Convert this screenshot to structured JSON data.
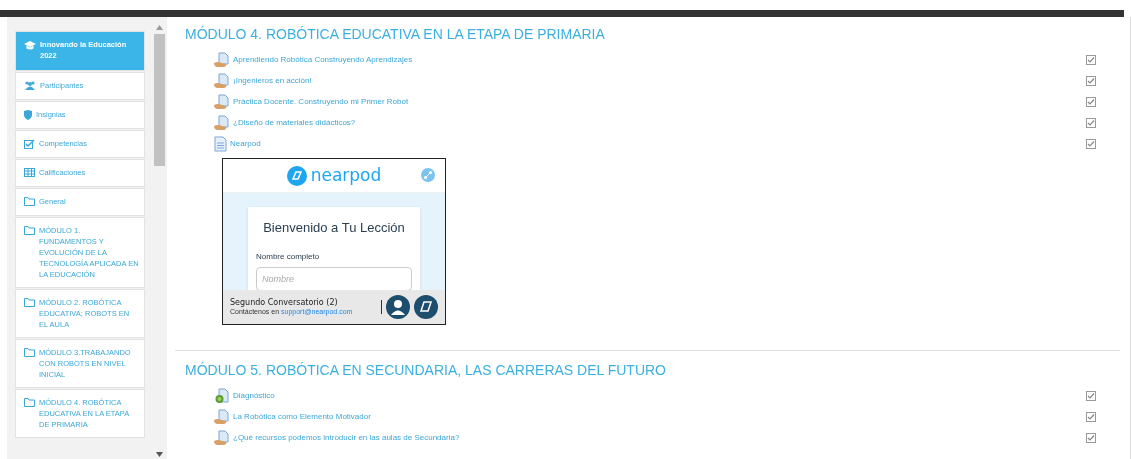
{
  "sidebar": {
    "items": [
      {
        "label": "Innovando la Educación 2022",
        "kind": "cap",
        "selected": true
      },
      {
        "label": "Participantes",
        "kind": "users",
        "selected": false
      },
      {
        "label": "Insignias",
        "kind": "shield",
        "selected": false
      },
      {
        "label": "Competencias",
        "kind": "check",
        "selected": false
      },
      {
        "label": "Calificaciones",
        "kind": "table",
        "selected": false
      },
      {
        "label": "General",
        "kind": "folder",
        "selected": false
      },
      {
        "label": "MÓDULO 1. FUNDAMENTOS Y EVOLUCIÓN DE LA TECNOLOGÍA APLICADA EN LA EDUCACIÓN",
        "kind": "folder",
        "selected": false
      },
      {
        "label": "MÓDULO 2. ROBÓTICA EDUCATIVA; ROBOTS EN EL AULA",
        "kind": "folder",
        "selected": false
      },
      {
        "label": "MÓDULO 3.TRABAJANDO CON ROBOTS EN NIVEL INICIAL",
        "kind": "folder",
        "selected": false
      },
      {
        "label": "MÓDULO 4. ROBÓTICA EDUCATIVA EN LA ETAPA DE PRIMARIA",
        "kind": "folder",
        "selected": false
      }
    ]
  },
  "sections": [
    {
      "title": "MÓDULO 4. ROBÓTICA EDUCATIVA EN LA ETAPA DE PRIMARIA",
      "activities": [
        {
          "label": "Aprendiendo Robótica Construyendo Aprendizajes",
          "kind": "lesson",
          "completed": true
        },
        {
          "label": "¡Ingenieros en acción!",
          "kind": "lesson",
          "completed": true
        },
        {
          "label": "Práctica Docente. Construyendo mi Primer Robot",
          "kind": "lesson",
          "completed": true
        },
        {
          "label": "¿Diseño de materiales didácticos?",
          "kind": "lesson",
          "completed": true
        },
        {
          "label": "Nearpod",
          "kind": "page",
          "completed": true
        }
      ],
      "embed": {
        "brand": "nearpod",
        "heading": "Bienvenido a Tu Lección",
        "field_label": "Nombre completo",
        "placeholder": "Nombre",
        "lesson_title": "Segundo Conversatorio (2)",
        "contact_text": "Contáctenos en",
        "contact_link": "support@nearpod.com"
      }
    },
    {
      "title": "MÓDULO 5. ROBÓTICA EN SECUNDARIA, LAS CARRERAS DEL FUTURO",
      "activities": [
        {
          "label": "Diagnóstico",
          "kind": "quiz",
          "completed": true
        },
        {
          "label": "La Robótica como Elemento Motivador",
          "kind": "lesson",
          "completed": true
        },
        {
          "label": "¿Qué recursos podemos introducir en las aulas de Secundaria?",
          "kind": "lesson",
          "completed": true
        }
      ]
    }
  ]
}
